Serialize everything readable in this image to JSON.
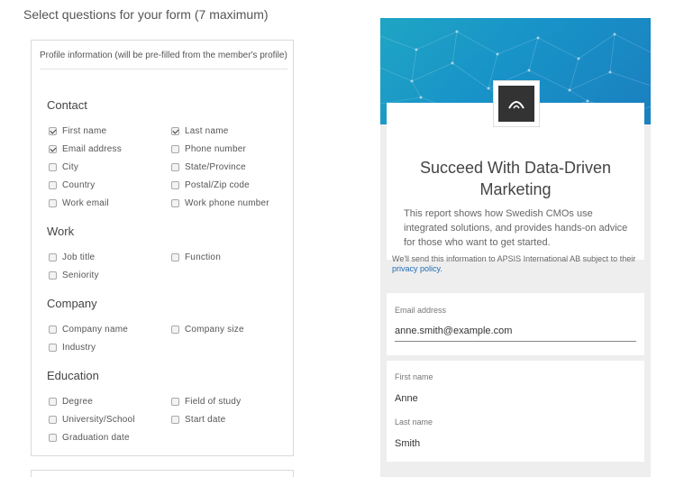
{
  "page": {
    "heading": "Select questions for your form (7 maximum)"
  },
  "panel": {
    "note": "Profile information (will be pre-filled from the member's profile)",
    "groups": [
      {
        "title": "Contact",
        "items": [
          {
            "label": "First name",
            "checked": true
          },
          {
            "label": "Last name",
            "checked": true
          },
          {
            "label": "Email address",
            "checked": true
          },
          {
            "label": "Phone number",
            "checked": false
          },
          {
            "label": "City",
            "checked": false
          },
          {
            "label": "State/Province",
            "checked": false
          },
          {
            "label": "Country",
            "checked": false
          },
          {
            "label": "Postal/Zip code",
            "checked": false
          },
          {
            "label": "Work email",
            "checked": false
          },
          {
            "label": "Work phone number",
            "checked": false
          }
        ]
      },
      {
        "title": "Work",
        "items": [
          {
            "label": "Job title",
            "checked": false
          },
          {
            "label": "Function",
            "checked": false
          },
          {
            "label": "Seniority",
            "checked": false
          }
        ]
      },
      {
        "title": "Company",
        "items": [
          {
            "label": "Company name",
            "checked": false
          },
          {
            "label": "Company size",
            "checked": false
          },
          {
            "label": "Industry",
            "checked": false
          }
        ]
      },
      {
        "title": "Education",
        "items": [
          {
            "label": "Degree",
            "checked": false
          },
          {
            "label": "Field of study",
            "checked": false
          },
          {
            "label": "University/School",
            "checked": false
          },
          {
            "label": "Start date",
            "checked": false
          },
          {
            "label": "Graduation date",
            "checked": false
          }
        ]
      }
    ]
  },
  "preview": {
    "title": "Succeed With Data-Driven Marketing",
    "description": "This report shows how Swedish CMOs use integrated solutions, and provides hands-on advice for those who want to get started.",
    "consent_prefix": "We'll send this information to APSIS International AB subject to their ",
    "consent_link": "privacy policy",
    "consent_suffix": ".",
    "fields": {
      "email": {
        "label": "Email address",
        "value": "anne.smith@example.com"
      },
      "first_name": {
        "label": "First name",
        "value": "Anne"
      },
      "last_name": {
        "label": "Last name",
        "value": "Smith"
      }
    },
    "colors": {
      "banner": "#1893c8",
      "logo": "#333333",
      "link": "#1d6db3"
    }
  }
}
